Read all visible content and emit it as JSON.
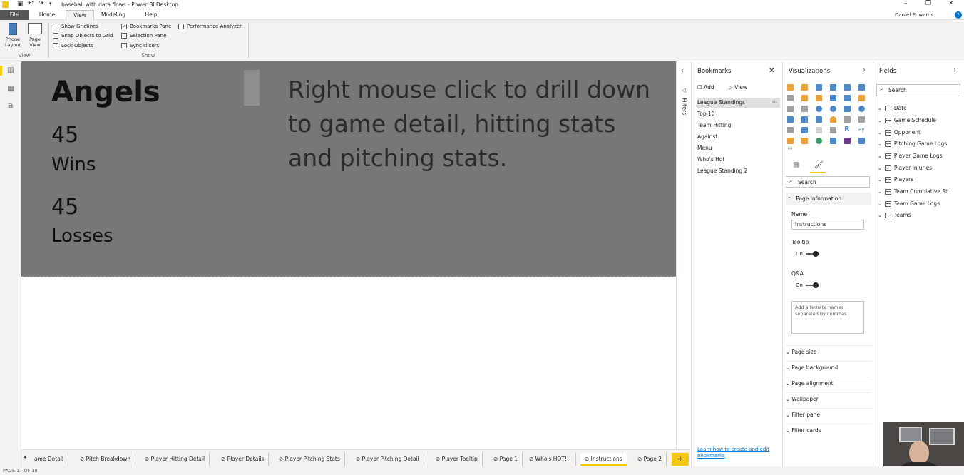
{
  "window": {
    "title": "baseball with data flows - Power BI Desktop",
    "user": "Daniel Edwards"
  },
  "ribbon": {
    "tabs": [
      "File",
      "Home",
      "View",
      "Modeling",
      "Help"
    ],
    "phone_layout": "Phone Layout",
    "page_view": "Page View",
    "view_group": "View",
    "show_group": "Show",
    "checkboxes": [
      {
        "label": "Show Gridlines",
        "checked": false
      },
      {
        "label": "Snap Objects to Grid",
        "checked": false
      },
      {
        "label": "Lock Objects",
        "checked": false
      },
      {
        "label": "Bookmarks Pane",
        "checked": true
      },
      {
        "label": "Selection Pane",
        "checked": false
      },
      {
        "label": "Sync slicers",
        "checked": false
      },
      {
        "label": "Performance Analyzer",
        "checked": false
      }
    ]
  },
  "canvas": {
    "team": "Angels",
    "wins_value": "45",
    "wins_label": "Wins",
    "losses_value": "45",
    "losses_label": "Losses",
    "instructions": "Right mouse click to drill down to game detail, hitting stats and pitching stats."
  },
  "filters": {
    "label": "Filters"
  },
  "bookmarks": {
    "title": "Bookmarks",
    "add": "Add",
    "view": "View",
    "items": [
      "League Standings",
      "Top 10",
      "Team Hitting",
      "Against",
      "Menu",
      "Who's Hot",
      "League Standing 2"
    ],
    "footer_link": "Learn how to create and edit bookmarks"
  },
  "visualizations": {
    "title": "Visualizations",
    "search_placeholder": "Search",
    "page_information": "Page information",
    "name_label": "Name",
    "name_value": "Instructions",
    "tooltip_label": "Tooltip",
    "tooltip_state": "On",
    "qa_label": "Q&A",
    "qa_state": "On",
    "alt_names_placeholder": "Add alternate names separated by commas",
    "sections": [
      "Page size",
      "Page background",
      "Page alignment",
      "Wallpaper",
      "Filter pane",
      "Filter cards"
    ]
  },
  "fields": {
    "title": "Fields",
    "search_placeholder": "Search",
    "tables": [
      "Date",
      "Game Schedule",
      "Opponent",
      "Pitching Game Logs",
      "Player Game Logs",
      "Player Injuries",
      "Players",
      "Team Cumulative St...",
      "Team Game Logs",
      "Teams"
    ]
  },
  "page_tabs": [
    "ame Detail",
    "Pitch Breakdown",
    "Player Hitting Detail",
    "Player Details",
    "Player Pitching Stats",
    "Player Pitching Detail",
    "Player Tooltip",
    "Page 1",
    "Who's HOT!!!",
    "Instructions",
    "Page 2"
  ],
  "status": {
    "page": "PAGE 17 OF 18"
  },
  "colors": {
    "canvas_bg": "#787679",
    "accent": "#f2c811",
    "file_tab": "#555555"
  }
}
